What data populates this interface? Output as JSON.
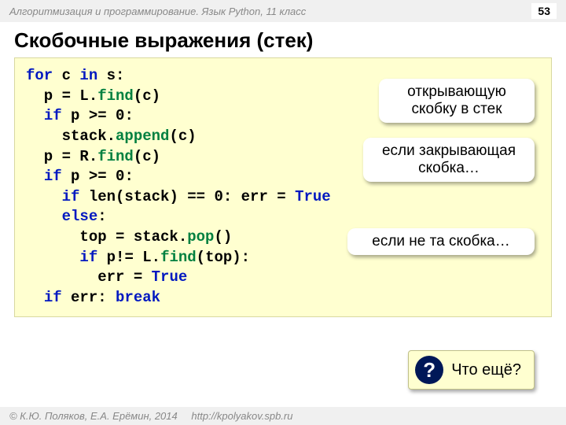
{
  "header": {
    "course": "Алгоритмизация и программирование. Язык Python, 11 класс",
    "page": "53"
  },
  "title": "Скобочные выражения (стек)",
  "code": {
    "tokens": [
      [
        {
          "t": "for ",
          "c": "kw"
        },
        {
          "t": "c "
        },
        {
          "t": "in ",
          "c": "kw"
        },
        {
          "t": "s:"
        }
      ],
      [
        {
          "t": "  p = L."
        },
        {
          "t": "find",
          "c": "fn"
        },
        {
          "t": "(c)"
        }
      ],
      [
        {
          "t": "  "
        },
        {
          "t": "if ",
          "c": "kw"
        },
        {
          "t": "p >= 0:"
        }
      ],
      [
        {
          "t": "    stack."
        },
        {
          "t": "append",
          "c": "fn"
        },
        {
          "t": "(c)"
        }
      ],
      [
        {
          "t": "  p = R."
        },
        {
          "t": "find",
          "c": "fn"
        },
        {
          "t": "(c)"
        }
      ],
      [
        {
          "t": "  "
        },
        {
          "t": "if ",
          "c": "kw"
        },
        {
          "t": "p >= 0:"
        }
      ],
      [
        {
          "t": "    "
        },
        {
          "t": "if ",
          "c": "kw"
        },
        {
          "t": "len(stack) == 0: err = "
        },
        {
          "t": "True",
          "c": "bool"
        }
      ],
      [
        {
          "t": "    "
        },
        {
          "t": "else",
          "c": "kw"
        },
        {
          "t": ":"
        }
      ],
      [
        {
          "t": "      top = stack."
        },
        {
          "t": "pop",
          "c": "fn"
        },
        {
          "t": "()"
        }
      ],
      [
        {
          "t": "      "
        },
        {
          "t": "if ",
          "c": "kw"
        },
        {
          "t": "p!= L."
        },
        {
          "t": "find",
          "c": "fn"
        },
        {
          "t": "(top):"
        }
      ],
      [
        {
          "t": "        err = "
        },
        {
          "t": "True",
          "c": "bool"
        }
      ],
      [
        {
          "t": "  "
        },
        {
          "t": "if ",
          "c": "kw"
        },
        {
          "t": "err: "
        },
        {
          "t": "break",
          "c": "kw"
        }
      ]
    ]
  },
  "callouts": {
    "c1": "открывающую скобку в стек",
    "c2": "если закрывающая скобка…",
    "c3": "если не та скобка…"
  },
  "question": {
    "mark": "?",
    "text": "Что ещё?"
  },
  "footer": {
    "copyright": "© К.Ю. Поляков, Е.А. Ерёмин, 2014",
    "url": "http://kpolyakov.spb.ru"
  }
}
